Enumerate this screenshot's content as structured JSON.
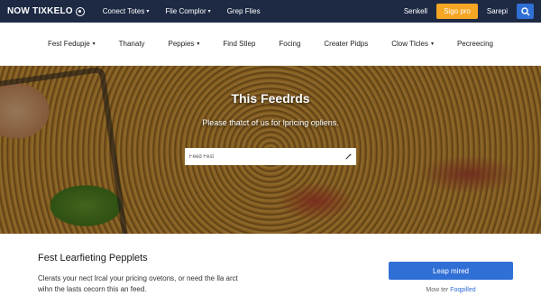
{
  "topbar": {
    "brand": "NOW TIXKELO",
    "nav": [
      {
        "label": "Conect Totes",
        "caret": true
      },
      {
        "label": "Flie Complor",
        "caret": true
      },
      {
        "label": "Grep Flies",
        "caret": false
      }
    ],
    "right_link": "Senkell",
    "signup_label": "Sigo pro",
    "signin_label": "Sarepi"
  },
  "subnav": {
    "items": [
      {
        "label": "Fest Fedupje",
        "caret": true
      },
      {
        "label": "Thanaty",
        "caret": false
      },
      {
        "label": "Peppies",
        "caret": true
      },
      {
        "label": "Find Stlep",
        "caret": false
      },
      {
        "label": "Focing",
        "caret": false
      },
      {
        "label": "Creater Pidps",
        "caret": false
      },
      {
        "label": "Clow Tlcles",
        "caret": true
      },
      {
        "label": "Pecreecing",
        "caret": false
      }
    ]
  },
  "hero": {
    "title": "This Feedrds",
    "subtitle": "Please thatct of us for lpricing opliens.",
    "search_placeholder": "Feed Fest"
  },
  "bottom": {
    "title": "Fest Learfieting Pepplets",
    "desc_line1": "Clerats your nect lrcal your pricing ovetons, or need the lla arct",
    "desc_line2": "wihn the lasts cecorn this an feed.",
    "cta_label": "Leap mired",
    "note_prefix": "Mow ter",
    "note_link": "Foqpilled"
  },
  "colors": {
    "topbar_bg": "#1e2a44",
    "signup_bg": "#f5a623",
    "primary_blue": "#2f6fd6"
  },
  "icons": {
    "brand": "logo-circle-icon",
    "caret": "chevron-down-icon",
    "search": "search-icon",
    "hero_search": "pencil-icon"
  }
}
